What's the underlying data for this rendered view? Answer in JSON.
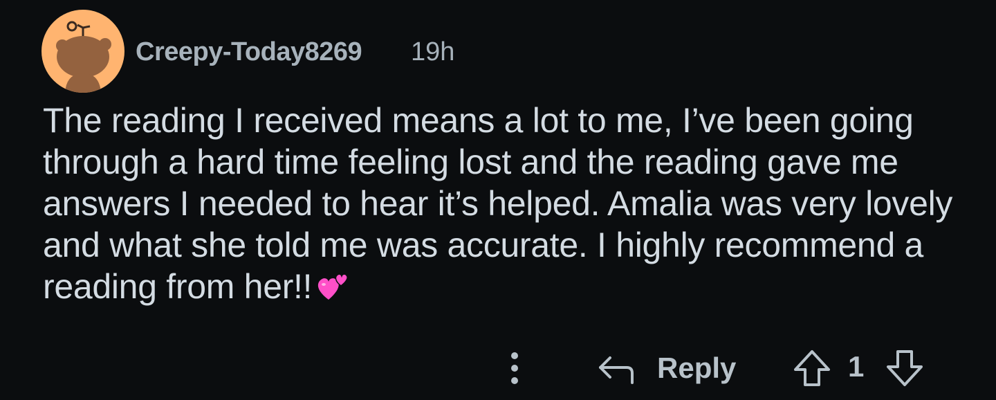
{
  "comment": {
    "username": "Creepy-Today8269",
    "timestamp": "19h",
    "text": "The reading I received means a lot to me, I’ve been going through a hard time feeling lost and the reading gave me answers I needed to hear it’s helped. Amalia was very lovely and what she told me was accurate. I highly recommend a reading from her!!",
    "emoji_icon": "two-hearts-emoji",
    "avatar_icon": "snoo-avatar-icon",
    "avatar_bg_color": "#ffb470"
  },
  "actions": {
    "more_icon": "more-vertical-icon",
    "reply_icon": "reply-arrow-icon",
    "reply_label": "Reply",
    "upvote_icon": "upvote-arrow-icon",
    "score": "1",
    "downvote_icon": "downvote-arrow-icon"
  },
  "colors": {
    "background": "#0b0d0f",
    "meta_text": "#a7b2bb",
    "body_text": "#d4dce3",
    "action_text": "#b8c2ca",
    "emoji_pink": "#ff4fc8"
  }
}
